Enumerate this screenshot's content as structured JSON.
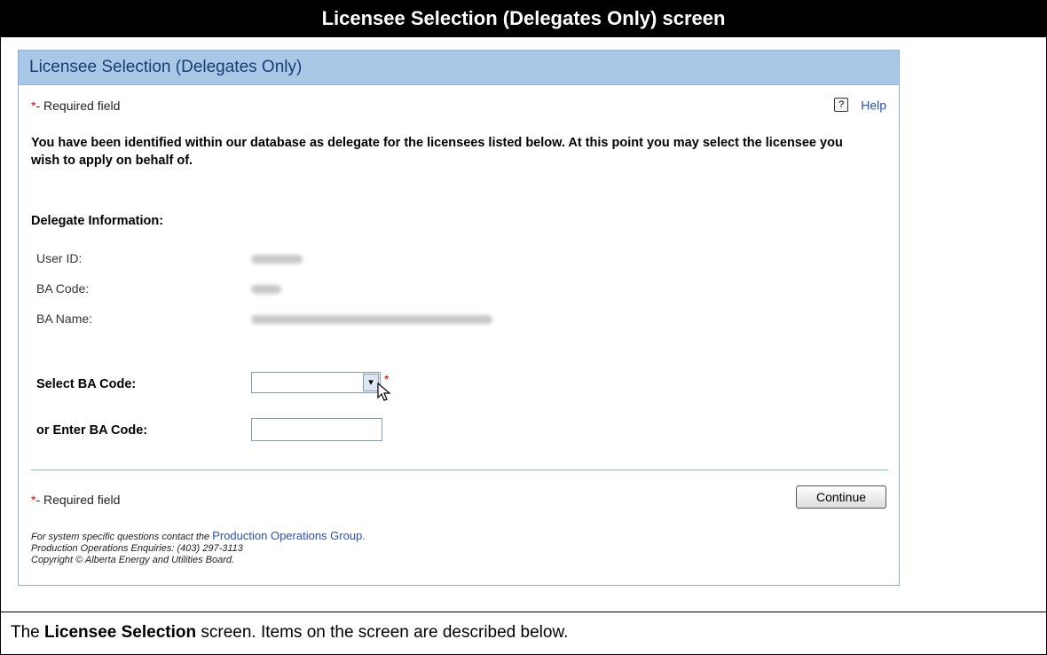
{
  "doc": {
    "banner_title": "Licensee Selection (Delegates Only) screen",
    "caption_prefix": "The ",
    "caption_bold": "Licensee Selection",
    "caption_suffix": " screen. Items on the screen are described below."
  },
  "panel": {
    "title": "Licensee Selection (Delegates Only)",
    "required_star": "*",
    "required_note": "- Required field",
    "help_icon_glyph": "?",
    "help_label": "Help",
    "intro_text": "You have been identified within our database as delegate for the licensees listed below. At this point you may select the licensee you wish to apply on behalf of."
  },
  "delegate_info": {
    "section_label": "Delegate Information:",
    "user_id_label": "User ID:",
    "ba_code_label": "BA Code:",
    "ba_name_label": "BA Name:"
  },
  "form": {
    "select_label": "Select BA Code:",
    "select_value": "",
    "select_arrow_glyph": "▾",
    "enter_label": "or Enter BA Code:",
    "enter_value": ""
  },
  "footer": {
    "continue_label": "Continue",
    "contact_prefix": "For system specific questions contact the ",
    "contact_link": "Production Operations Group.",
    "enquiries": "Production Operations Enquiries: (403) 297-3113",
    "copyright": "Copyright © Alberta Energy and Utilities Board."
  }
}
